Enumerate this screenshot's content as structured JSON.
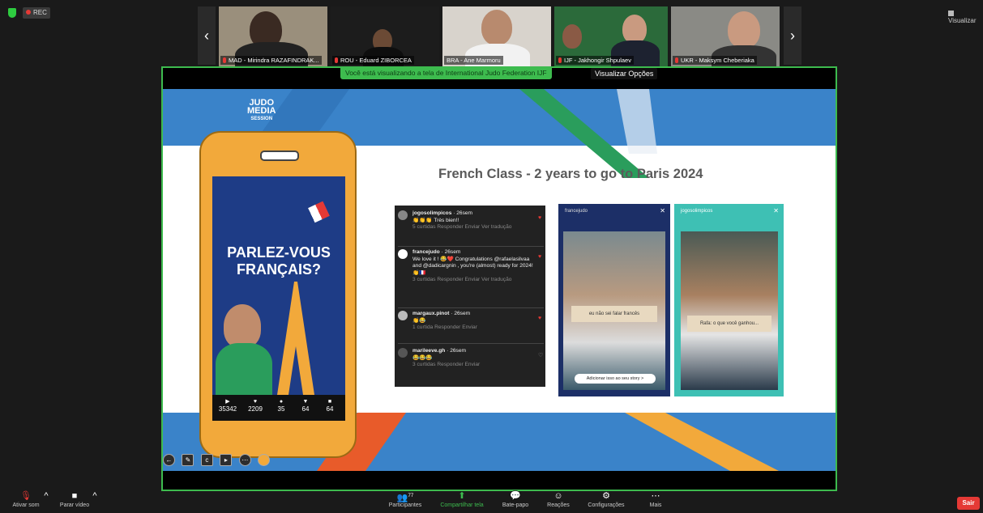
{
  "topbar": {
    "rec_label": "REC",
    "view_label": "Visualizar"
  },
  "participants": [
    {
      "name": "MAD - Mirindra RAZAFINDRAK..."
    },
    {
      "name": "ROU - Eduard ZIBORCEA"
    },
    {
      "name": "BRA - Ane Marmoru"
    },
    {
      "name": "IJF - Jakhongir Shpulaev"
    },
    {
      "name": "IJF - Jakhongir Shpulaev"
    },
    {
      "name": "UKR - Maksym Cheberiaka"
    }
  ],
  "share": {
    "banner": "Você está visualizando a tela de International Judo Federation IJF",
    "view_options": "Visualizar Opções"
  },
  "slide": {
    "logo_lines": [
      "JUDO",
      "MEDIA",
      "SESSION"
    ],
    "title": "French Class - 2 years to go to Paris 2024",
    "phone_text": "PARLEZ-VOUS FRANÇAIS?",
    "stats": [
      "35342",
      "2209",
      "35",
      "64",
      "64"
    ],
    "comments": [
      {
        "user": "jogosolimpicos",
        "time": "26sem",
        "text": "👏👏👏 Très bien!!",
        "meta": "5 curtidas  Responder  Enviar  Ver tradução"
      },
      {
        "user": "francejudo",
        "time": "26sem",
        "text": "We love it ! 😂❤️ Congratulations @rafaelasilvaa and @dadicargnin , you're (almost) ready for 2024! 👏🇫🇷",
        "meta": "3 curtidas  Responder  Enviar  Ver tradução"
      },
      {
        "user": "margaux.pinot",
        "time": "26sem",
        "text": "👏😂",
        "meta": "1 curtida  Responder  Enviar"
      },
      {
        "user": "marileeve.gh",
        "time": "26sem",
        "text": "😂😂😂",
        "meta": "3 curtidas  Responder  Enviar"
      }
    ],
    "story1": {
      "user": "francejudo",
      "caption": "eu não sei falar francês",
      "button": "Adicionar isso ao seu story >"
    },
    "story2": {
      "user": "jogosolimpicos",
      "caption": "Rafa: o que você ganhou..."
    }
  },
  "toolbar": {
    "mic_label": "Ativar som",
    "video_label": "Parar vídeo",
    "participants_label": "Participantes",
    "participants_count": "77",
    "share_label": "Compartilhar tela",
    "chat_label": "Bate-papo",
    "reactions_label": "Reações",
    "settings_label": "Configurações",
    "more_label": "Mais",
    "leave_label": "Sair"
  },
  "colors": {
    "accent": "#3dbb4e",
    "leave": "#e53935",
    "slide_blue": "#3a83c9",
    "phone": "#f2a93b"
  }
}
